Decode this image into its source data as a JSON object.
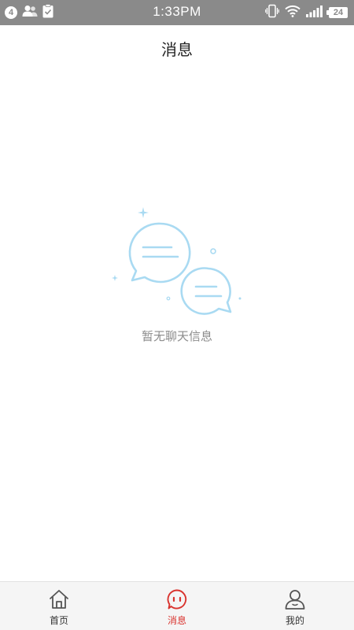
{
  "status_bar": {
    "notification_count": "4",
    "time": "1:33PM",
    "battery": "24",
    "left_icons": [
      "notification-count-icon",
      "contacts-icon",
      "clipboard-icon"
    ],
    "right_icons": [
      "vibrate-icon",
      "wifi-icon",
      "signal-icon",
      "battery-icon"
    ]
  },
  "header": {
    "title": "消息"
  },
  "empty_state": {
    "icon": "chat-bubbles-icon",
    "text": "暂无聊天信息"
  },
  "bottom_nav": {
    "items": [
      {
        "label": "首页",
        "icon": "home-icon",
        "active": false
      },
      {
        "label": "消息",
        "icon": "message-icon",
        "active": true
      },
      {
        "label": "我的",
        "icon": "profile-icon",
        "active": false
      }
    ]
  },
  "colors": {
    "status_bar_bg": "#8a8a8a",
    "accent": "#d9342f",
    "illustration": "#a9daf2",
    "nav_bg": "#f5f5f5",
    "empty_text": "#8c8c8c"
  }
}
